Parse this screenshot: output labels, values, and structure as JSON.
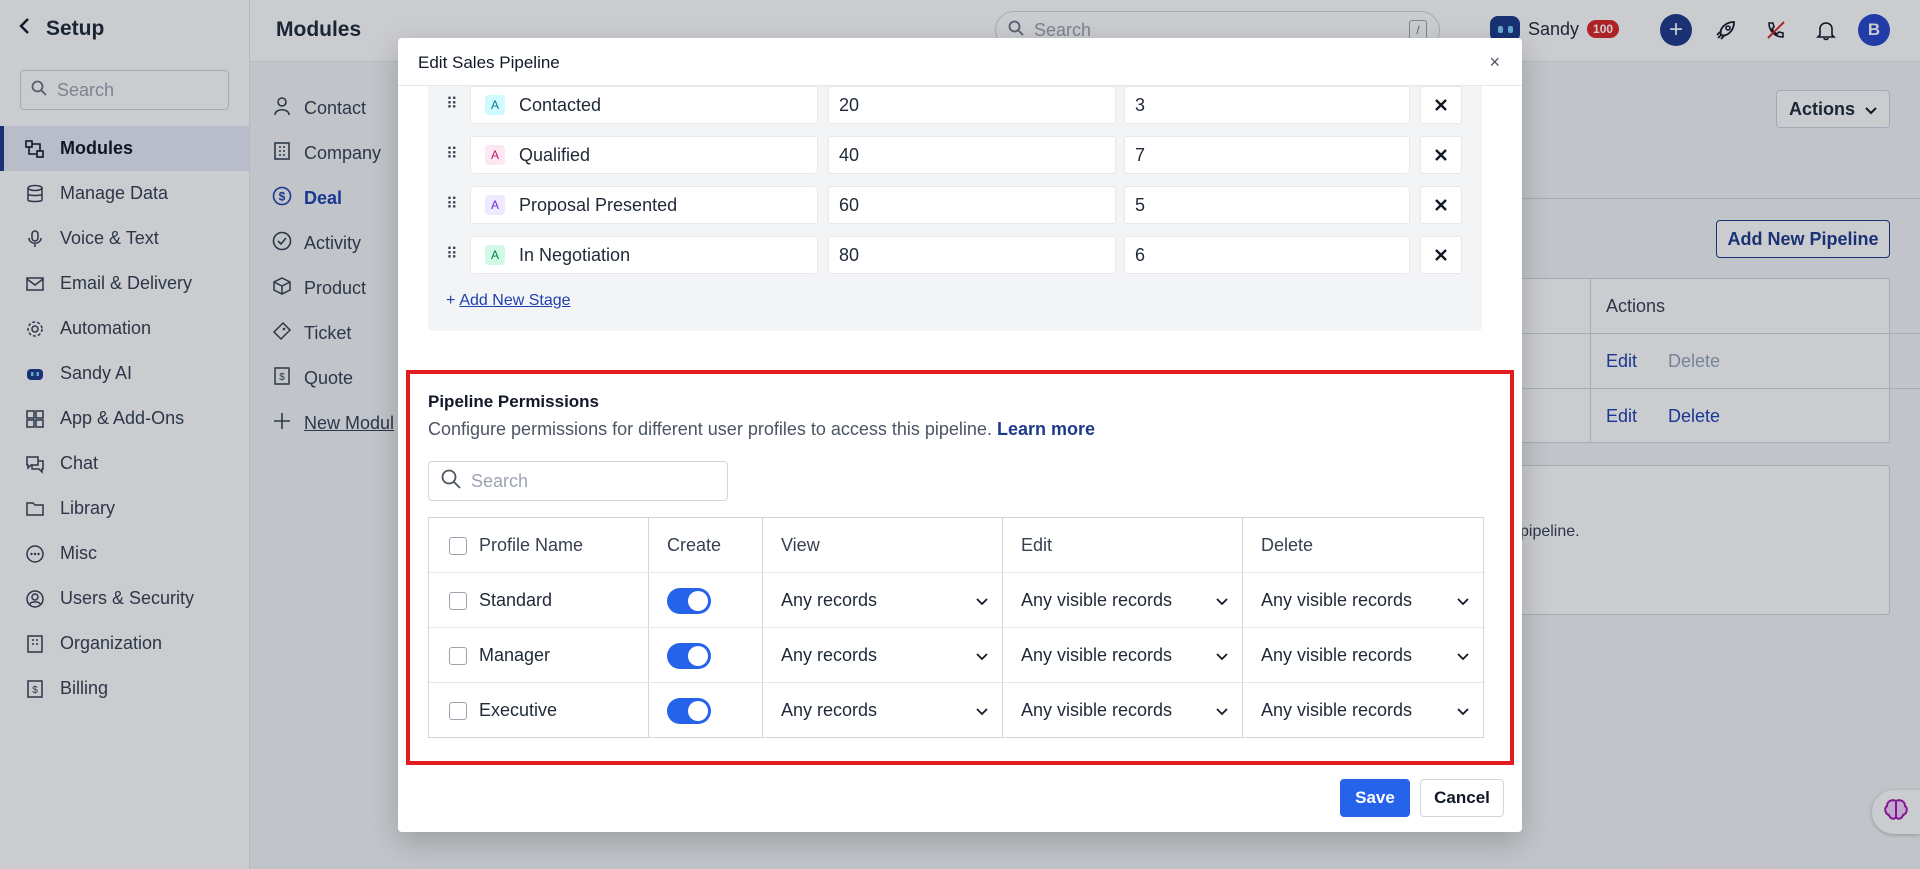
{
  "sidebar": {
    "title": "Setup",
    "search_placeholder": "Search",
    "items": [
      {
        "label": "Modules",
        "icon": "modules-icon",
        "active": true
      },
      {
        "label": "Manage Data",
        "icon": "database-icon"
      },
      {
        "label": "Voice & Text",
        "icon": "microphone-icon"
      },
      {
        "label": "Email & Delivery",
        "icon": "mail-icon"
      },
      {
        "label": "Automation",
        "icon": "automation-gear-icon"
      },
      {
        "label": "Sandy AI",
        "icon": "sandy-bot-icon"
      },
      {
        "label": "App & Add-Ons",
        "icon": "apps-grid-icon"
      },
      {
        "label": "Chat",
        "icon": "chat-icon"
      },
      {
        "label": "Library",
        "icon": "folder-icon"
      },
      {
        "label": "Misc",
        "icon": "more-circle-icon"
      },
      {
        "label": "Users & Security",
        "icon": "user-shield-icon"
      },
      {
        "label": "Organization",
        "icon": "building-icon"
      },
      {
        "label": "Billing",
        "icon": "billing-icon"
      }
    ]
  },
  "topbar": {
    "page_title": "Modules",
    "search_placeholder": "Search",
    "search_shortcut": "/",
    "user_name": "Sandy",
    "credit_count": "100",
    "avatar_letter": "B"
  },
  "modules_nav": [
    {
      "label": "Contact",
      "icon": "person-icon"
    },
    {
      "label": "Company",
      "icon": "company-icon"
    },
    {
      "label": "Deal",
      "icon": "dollar-circle-icon",
      "active": true
    },
    {
      "label": "Activity",
      "icon": "check-circle-icon"
    },
    {
      "label": "Product",
      "icon": "box-icon"
    },
    {
      "label": "Ticket",
      "icon": "ticket-icon"
    },
    {
      "label": "Quote",
      "icon": "quote-icon"
    },
    {
      "label": "New Modul",
      "icon": "plus-icon"
    }
  ],
  "background": {
    "actions_label": "Actions",
    "add_pipeline_label": "Add New Pipeline",
    "table_header_actions": "Actions",
    "rows": [
      {
        "edit": "Edit",
        "delete": "Delete",
        "delete_disabled": true
      },
      {
        "edit": "Edit",
        "delete": "Delete",
        "delete_disabled": false
      }
    ],
    "note_fragment": "pipeline."
  },
  "modal": {
    "title": "Edit Sales Pipeline",
    "close_glyph": "×",
    "stages": [
      {
        "name": "Contacted",
        "probability": "20",
        "days": "3",
        "badge": "A",
        "badge_bg": "#cffafe",
        "badge_fg": "#0e7490"
      },
      {
        "name": "Qualified",
        "probability": "40",
        "days": "7",
        "badge": "A",
        "badge_bg": "#fce7f3",
        "badge_fg": "#be185d"
      },
      {
        "name": "Proposal Presented",
        "probability": "60",
        "days": "5",
        "badge": "A",
        "badge_bg": "#ede9fe",
        "badge_fg": "#6d28d9"
      },
      {
        "name": "In Negotiation",
        "probability": "80",
        "days": "6",
        "badge": "A",
        "badge_bg": "#d1fae5",
        "badge_fg": "#047857"
      }
    ],
    "add_stage_label": "Add New Stage",
    "permissions": {
      "title": "Pipeline Permissions",
      "description": "Configure permissions for different user profiles to access this pipeline.",
      "learn_more": "Learn more",
      "search_placeholder": "Search",
      "columns": {
        "profile": "Profile Name",
        "create": "Create",
        "view": "View",
        "edit": "Edit",
        "delete": "Delete"
      },
      "rows": [
        {
          "profile": "Standard",
          "create": true,
          "view": "Any records",
          "edit": "Any visible records",
          "delete": "Any visible records"
        },
        {
          "profile": "Manager",
          "create": true,
          "view": "Any records",
          "edit": "Any visible records",
          "delete": "Any visible records"
        },
        {
          "profile": "Executive",
          "create": true,
          "view": "Any records",
          "edit": "Any visible records",
          "delete": "Any visible records"
        }
      ]
    },
    "save_label": "Save",
    "cancel_label": "Cancel"
  },
  "colors": {
    "accent": "#2563eb",
    "brand_navy": "#1e3a8a",
    "highlight_border": "#e11d22"
  }
}
